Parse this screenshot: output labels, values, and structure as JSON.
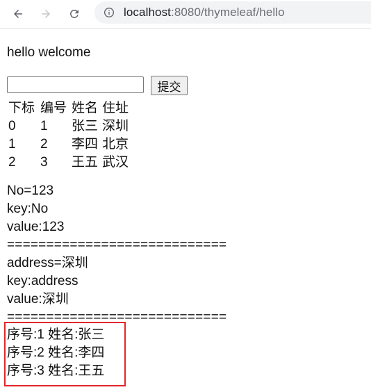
{
  "browser": {
    "url_host": "localhost",
    "url_rest": ":8080/thymeleaf/hello"
  },
  "page": {
    "greeting": "hello welcome",
    "search_placeholder": "",
    "submit_label": "提交",
    "table": {
      "headers": [
        "下标",
        "编号",
        "姓名",
        "住址"
      ],
      "rows": [
        [
          "0",
          "1",
          "张三",
          "深圳"
        ],
        [
          "1",
          "2",
          "李四",
          "北京"
        ],
        [
          "2",
          "3",
          "王五",
          "武汉"
        ]
      ]
    },
    "map_lines": [
      "No=123",
      "key:No",
      "value:123",
      "============================",
      "address=深圳",
      "key:address",
      "value:深圳",
      "============================"
    ],
    "sequence_lines": [
      "序号:1 姓名:张三",
      "序号:2 姓名:李四",
      "序号:3 姓名:王五"
    ],
    "highlight_color": "#e0262a"
  }
}
